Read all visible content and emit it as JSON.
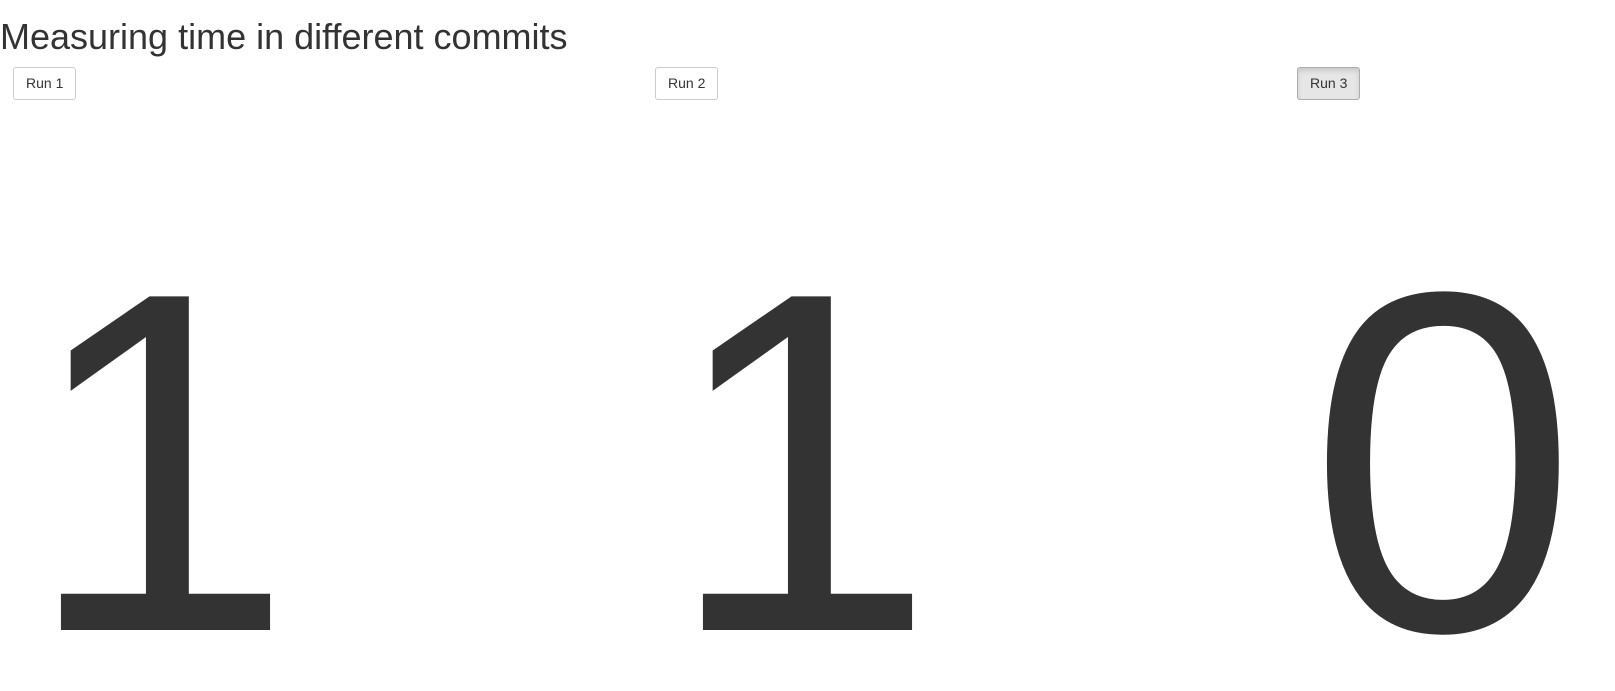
{
  "page": {
    "title": "Measuring time in different commits"
  },
  "runs": [
    {
      "button_label": "Run 1",
      "value": "1",
      "active": false
    },
    {
      "button_label": "Run 2",
      "value": "1",
      "active": false
    },
    {
      "button_label": "Run 3",
      "value": "0",
      "active": true
    }
  ],
  "colors": {
    "text": "#333333",
    "button_border": "#cccccc",
    "button_active_bg": "#e6e6e6"
  }
}
